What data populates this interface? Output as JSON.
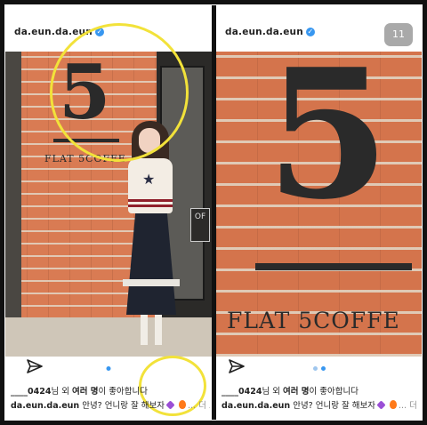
{
  "left_post": {
    "username": "da.eun.da.eun",
    "verified_icon": "verified-badge-icon",
    "sign_number": "5",
    "sign_text": "FLAT 5COFFE",
    "door_sign": "OF",
    "likes_user": "____0424",
    "likes_text_1": "님 외 ",
    "likes_bold": "여러 명",
    "likes_text_2": "이 좋아합니다",
    "caption_user": "da.eun.da.eun",
    "caption_text": " 안녕? 언니랑 잘 해보자",
    "more_label": "... 더 보기",
    "send_icon": "send-paper-plane-icon",
    "carousel_dots": 1
  },
  "right_post": {
    "username": "da.eun.da.eun",
    "verified_icon": "verified-badge-icon",
    "counter": "11",
    "sign_number": "5",
    "sign_text": "FLAT 5COFFE",
    "likes_user": "____0424",
    "likes_text_1": "님 외 ",
    "likes_bold": "여러 명",
    "likes_text_2": "이 좋아합니다",
    "caption_user": "da.eun.da.eun",
    "caption_text": " 안녕? 언니랑 잘 해보자",
    "more_label": "... 더 보기",
    "send_icon": "send-paper-plane-icon",
    "carousel_dots": 2
  },
  "colors": {
    "highlight_circle": "#f2e23a",
    "brick": "#d97b53",
    "verified": "#3897f0",
    "carousel_active": "#3897f0",
    "heart_emoji": "#9b4fd6",
    "fire_emoji": "#ff7a1a"
  }
}
